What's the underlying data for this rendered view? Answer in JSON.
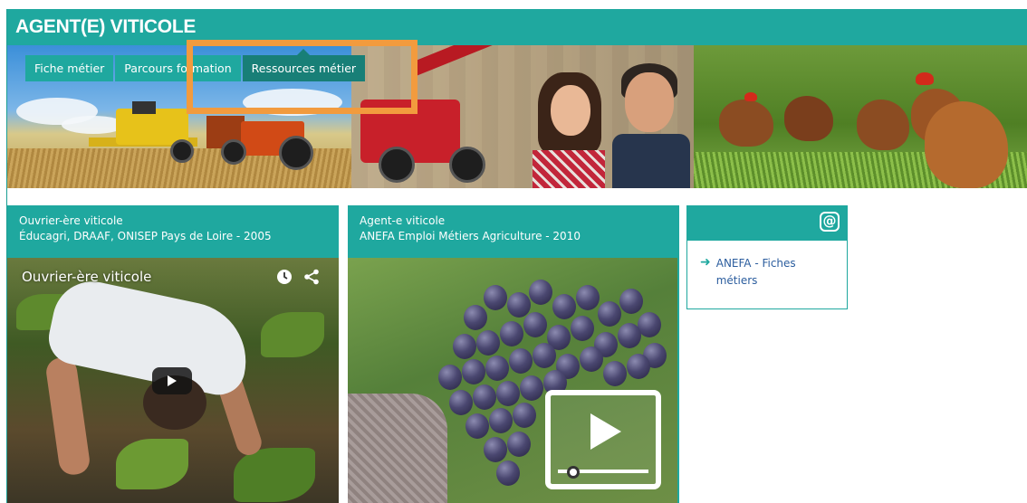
{
  "page": {
    "title": "AGENT(E) VITICOLE"
  },
  "tabs": [
    {
      "label": "Fiche métier",
      "active": false
    },
    {
      "label": "Parcours formation",
      "active": false
    },
    {
      "label": "Ressources métier",
      "active": true
    }
  ],
  "cards": [
    {
      "title_line1": "Ouvrier-ère viticole",
      "title_line2": "Éducagri, DRAAF, ONISEP Pays de Loire - 2005",
      "video_title": "Ouvrier-ère viticole",
      "icons": [
        "clock-icon",
        "share-icon",
        "play-icon"
      ]
    },
    {
      "title_line1": "Agent-e viticole",
      "title_line2": "ANEFA Emploi Métiers Agriculture - 2010",
      "icons": [
        "video-play-badge-icon"
      ]
    }
  ],
  "links_card": {
    "icon": "at-icon",
    "links": [
      {
        "label": "ANEFA - Fiches métiers",
        "icon": "arrow-right-icon"
      }
    ]
  },
  "colors": {
    "accent": "#1fa89f",
    "accent_dark": "#187f77",
    "highlight": "#f29b3e",
    "link": "#2b5d9e"
  }
}
